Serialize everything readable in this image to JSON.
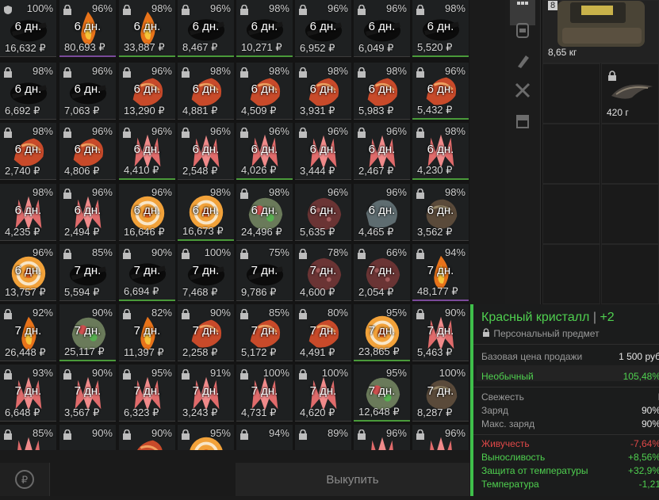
{
  "grid": {
    "cells": [
      {
        "pct": "100%",
        "days": "6 дн.",
        "price": "16,632 ₽",
        "icon": "shield-icon",
        "art": "dark",
        "q": ""
      },
      {
        "pct": "96%",
        "days": "6 дн.",
        "price": "80,693 ₽",
        "icon": "lock-icon",
        "art": "fire",
        "q": "purple"
      },
      {
        "pct": "98%",
        "days": "6 дн.",
        "price": "33,887 ₽",
        "icon": "lock-icon",
        "art": "fire",
        "q": "green"
      },
      {
        "pct": "96%",
        "days": "6 дн.",
        "price": "8,467 ₽",
        "icon": "lock-icon",
        "art": "dark",
        "q": "green"
      },
      {
        "pct": "98%",
        "days": "6 дн.",
        "price": "10,271 ₽",
        "icon": "lock-icon",
        "art": "dark",
        "q": "green"
      },
      {
        "pct": "96%",
        "days": "6 дн.",
        "price": "6,952 ₽",
        "icon": "lock-icon",
        "art": "dark",
        "q": ""
      },
      {
        "pct": "96%",
        "days": "6 дн.",
        "price": "6,049 ₽",
        "icon": "lock-icon",
        "art": "dark",
        "q": ""
      },
      {
        "pct": "98%",
        "days": "6 дн.",
        "price": "5,520 ₽",
        "icon": "lock-icon",
        "art": "dark",
        "q": "green"
      },
      {
        "pct": "98%",
        "days": "6 дн.",
        "price": "6,692 ₽",
        "icon": "lock-icon",
        "art": "dark",
        "q": ""
      },
      {
        "pct": "96%",
        "days": "6 дн.",
        "price": "7,063 ₽",
        "icon": "lock-icon",
        "art": "dark",
        "q": ""
      },
      {
        "pct": "96%",
        "days": "6 дн.",
        "price": "13,290 ₽",
        "icon": "lock-icon",
        "art": "red",
        "q": ""
      },
      {
        "pct": "98%",
        "days": "6 дн.",
        "price": "4,881 ₽",
        "icon": "lock-icon",
        "art": "red",
        "q": ""
      },
      {
        "pct": "98%",
        "days": "6 дн.",
        "price": "4,509 ₽",
        "icon": "lock-icon",
        "art": "red",
        "q": ""
      },
      {
        "pct": "98%",
        "days": "6 дн.",
        "price": "3,931 ₽",
        "icon": "lock-icon",
        "art": "red",
        "q": ""
      },
      {
        "pct": "98%",
        "days": "6 дн.",
        "price": "5,983 ₽",
        "icon": "lock-icon",
        "art": "red",
        "q": ""
      },
      {
        "pct": "96%",
        "days": "6 дн.",
        "price": "5,432 ₽",
        "icon": "lock-icon",
        "art": "red",
        "q": "green"
      },
      {
        "pct": "98%",
        "days": "6 дн.",
        "price": "2,740 ₽",
        "icon": "lock-icon",
        "art": "red",
        "q": ""
      },
      {
        "pct": "96%",
        "days": "6 дн.",
        "price": "4,806 ₽",
        "icon": "lock-icon",
        "art": "red",
        "q": ""
      },
      {
        "pct": "96%",
        "days": "6 дн.",
        "price": "4,410 ₽",
        "icon": "lock-icon",
        "art": "crystal",
        "q": "green"
      },
      {
        "pct": "96%",
        "days": "6 дн.",
        "price": "2,548 ₽",
        "icon": "lock-icon",
        "art": "crystal",
        "q": ""
      },
      {
        "pct": "96%",
        "days": "6 дн.",
        "price": "4,026 ₽",
        "icon": "lock-icon",
        "art": "crystal",
        "q": "green"
      },
      {
        "pct": "96%",
        "days": "6 дн.",
        "price": "3,444 ₽",
        "icon": "lock-icon",
        "art": "crystal",
        "q": ""
      },
      {
        "pct": "96%",
        "days": "6 дн.",
        "price": "2,467 ₽",
        "icon": "lock-icon",
        "art": "crystal",
        "q": ""
      },
      {
        "pct": "98%",
        "days": "6 дн.",
        "price": "4,230 ₽",
        "icon": "lock-icon",
        "art": "crystal",
        "q": "green"
      },
      {
        "pct": "98%",
        "days": "6 дн.",
        "price": "4,235 ₽",
        "icon": "",
        "art": "crystal",
        "q": ""
      },
      {
        "pct": "96%",
        "days": "6 дн.",
        "price": "2,494 ₽",
        "icon": "lock-icon",
        "art": "crystal",
        "q": ""
      },
      {
        "pct": "96%",
        "days": "6 дн.",
        "price": "16,646 ₽",
        "icon": "",
        "art": "swirl",
        "q": ""
      },
      {
        "pct": "98%",
        "days": "6 дн.",
        "price": "16,673 ₽",
        "icon": "",
        "art": "swirl",
        "q": "green"
      },
      {
        "pct": "98%",
        "days": "6 дн.",
        "price": "24,496 ₽",
        "icon": "lock-icon",
        "art": "moss",
        "q": ""
      },
      {
        "pct": "96%",
        "days": "6 дн.",
        "price": "5,635 ₽",
        "icon": "",
        "art": "rock",
        "q": ""
      },
      {
        "pct": "96%",
        "days": "6 дн.",
        "price": "4,465 ₽",
        "icon": "",
        "art": "gray",
        "q": ""
      },
      {
        "pct": "98%",
        "days": "6 дн.",
        "price": "3,562 ₽",
        "icon": "lock-icon",
        "art": "brown",
        "q": ""
      },
      {
        "pct": "96%",
        "days": "6 дн.",
        "price": "13,757 ₽",
        "icon": "",
        "art": "swirl",
        "q": ""
      },
      {
        "pct": "85%",
        "days": "7 дн.",
        "price": "5,594 ₽",
        "icon": "lock-icon",
        "art": "dark",
        "q": ""
      },
      {
        "pct": "90%",
        "days": "7 дн.",
        "price": "6,694 ₽",
        "icon": "lock-icon",
        "art": "dark",
        "q": "green"
      },
      {
        "pct": "100%",
        "days": "7 дн.",
        "price": "7,468 ₽",
        "icon": "lock-icon",
        "art": "dark",
        "q": ""
      },
      {
        "pct": "75%",
        "days": "7 дн.",
        "price": "9,786 ₽",
        "icon": "lock-icon",
        "art": "dark",
        "q": ""
      },
      {
        "pct": "78%",
        "days": "7 дн.",
        "price": "4,600 ₽",
        "icon": "lock-icon",
        "art": "rock",
        "q": ""
      },
      {
        "pct": "66%",
        "days": "7 дн.",
        "price": "2,054 ₽",
        "icon": "lock-icon",
        "art": "rock",
        "q": ""
      },
      {
        "pct": "94%",
        "days": "7 дн.",
        "price": "48,177 ₽",
        "icon": "lock-icon",
        "art": "fire",
        "q": "purple"
      },
      {
        "pct": "92%",
        "days": "7 дн.",
        "price": "26,448 ₽",
        "icon": "lock-icon",
        "art": "fire",
        "q": ""
      },
      {
        "pct": "90%",
        "days": "7 дн.",
        "price": "25,117 ₽",
        "icon": "",
        "art": "moss",
        "q": "green"
      },
      {
        "pct": "82%",
        "days": "7 дн.",
        "price": "11,397 ₽",
        "icon": "lock-icon",
        "art": "fire",
        "q": ""
      },
      {
        "pct": "90%",
        "days": "7 дн.",
        "price": "2,258 ₽",
        "icon": "lock-icon",
        "art": "red",
        "q": ""
      },
      {
        "pct": "85%",
        "days": "7 дн.",
        "price": "5,172 ₽",
        "icon": "lock-icon",
        "art": "red",
        "q": ""
      },
      {
        "pct": "80%",
        "days": "7 дн.",
        "price": "4,491 ₽",
        "icon": "lock-icon",
        "art": "red",
        "q": ""
      },
      {
        "pct": "95%",
        "days": "7 дн.",
        "price": "23,865 ₽",
        "icon": "",
        "art": "swirl",
        "q": "green"
      },
      {
        "pct": "90%",
        "days": "7 дн.",
        "price": "5,463 ₽",
        "icon": "lock-icon",
        "art": "crystal",
        "q": ""
      },
      {
        "pct": "93%",
        "days": "7 дн.",
        "price": "6,648 ₽",
        "icon": "lock-icon",
        "art": "crystal",
        "q": ""
      },
      {
        "pct": "90%",
        "days": "7 дн.",
        "price": "3,567 ₽",
        "icon": "lock-icon",
        "art": "crystal",
        "q": ""
      },
      {
        "pct": "95%",
        "days": "7 дн.",
        "price": "6,323 ₽",
        "icon": "lock-icon",
        "art": "crystal",
        "q": ""
      },
      {
        "pct": "91%",
        "days": "7 дн.",
        "price": "3,243 ₽",
        "icon": "lock-icon",
        "art": "crystal",
        "q": ""
      },
      {
        "pct": "100%",
        "days": "7 дн.",
        "price": "4,731 ₽",
        "icon": "lock-icon",
        "art": "crystal",
        "q": ""
      },
      {
        "pct": "100%",
        "days": "7 дн.",
        "price": "4,620 ₽",
        "icon": "lock-icon",
        "art": "crystal",
        "q": ""
      },
      {
        "pct": "95%",
        "days": "7 дн.",
        "price": "12,648 ₽",
        "icon": "",
        "art": "moss",
        "q": "green"
      },
      {
        "pct": "100%",
        "days": "7 дн.",
        "price": "8,287 ₽",
        "icon": "",
        "art": "brown",
        "q": ""
      },
      {
        "pct": "85%",
        "days": "",
        "price": "",
        "icon": "lock-icon",
        "art": "crystal",
        "q": ""
      },
      {
        "pct": "90%",
        "days": "",
        "price": "",
        "icon": "lock-icon",
        "art": "",
        "q": ""
      },
      {
        "pct": "90%",
        "days": "",
        "price": "",
        "icon": "lock-icon",
        "art": "red",
        "q": ""
      },
      {
        "pct": "95%",
        "days": "",
        "price": "",
        "icon": "lock-icon",
        "art": "swirl",
        "q": ""
      },
      {
        "pct": "94%",
        "days": "",
        "price": "",
        "icon": "lock-icon",
        "art": "",
        "q": ""
      },
      {
        "pct": "89%",
        "days": "",
        "price": "",
        "icon": "lock-icon",
        "art": "",
        "q": ""
      },
      {
        "pct": "96%",
        "days": "",
        "price": "",
        "icon": "lock-icon",
        "art": "crystal",
        "q": ""
      },
      {
        "pct": "96%",
        "days": "",
        "price": "",
        "icon": "lock-icon",
        "art": "crystal",
        "q": ""
      }
    ]
  },
  "footer": {
    "buy_label": "Выкупить",
    "currency_icon": "ruble-cycle-icon"
  },
  "sidebar": {
    "icons": [
      "grid-icon",
      "backpack-icon",
      "flashlight-icon",
      "tools-icon",
      "box-icon"
    ]
  },
  "inventory": {
    "backpack": {
      "badge": "8",
      "weight": "8,65 кг"
    },
    "item": {
      "weight": "420 г"
    }
  },
  "tooltip": {
    "title": "Красный кристалл",
    "upgrade": "+2",
    "personal": "Персональный предмет",
    "base_price_label": "Базовая цена продажи",
    "base_price_value": "1 500 руб",
    "rarity_label": "Необычный",
    "rarity_value": "105,48%",
    "stats": [
      {
        "label": "Свежесть",
        "value": "I",
        "color": "#9a9a9a"
      },
      {
        "label": "Заряд",
        "value": "90%",
        "color": "#9a9a9a"
      },
      {
        "label": "Макс. заряд",
        "value": "90%",
        "color": "#9a9a9a"
      }
    ],
    "effects": [
      {
        "label": "Живучесть",
        "value": "-7,64%",
        "color": "#e04848"
      },
      {
        "label": "Выносливость",
        "value": "+8,56%",
        "color": "#4fd04f"
      },
      {
        "label": "Защита от температуры",
        "value": "+32,9%",
        "color": "#4fd04f"
      },
      {
        "label": "Температура",
        "value": "-1,21",
        "color": "#4fd04f"
      }
    ],
    "colors": {
      "accent": "#3fbf4a",
      "base": "#9a9a9a",
      "rarity": "#4fd04f"
    }
  }
}
